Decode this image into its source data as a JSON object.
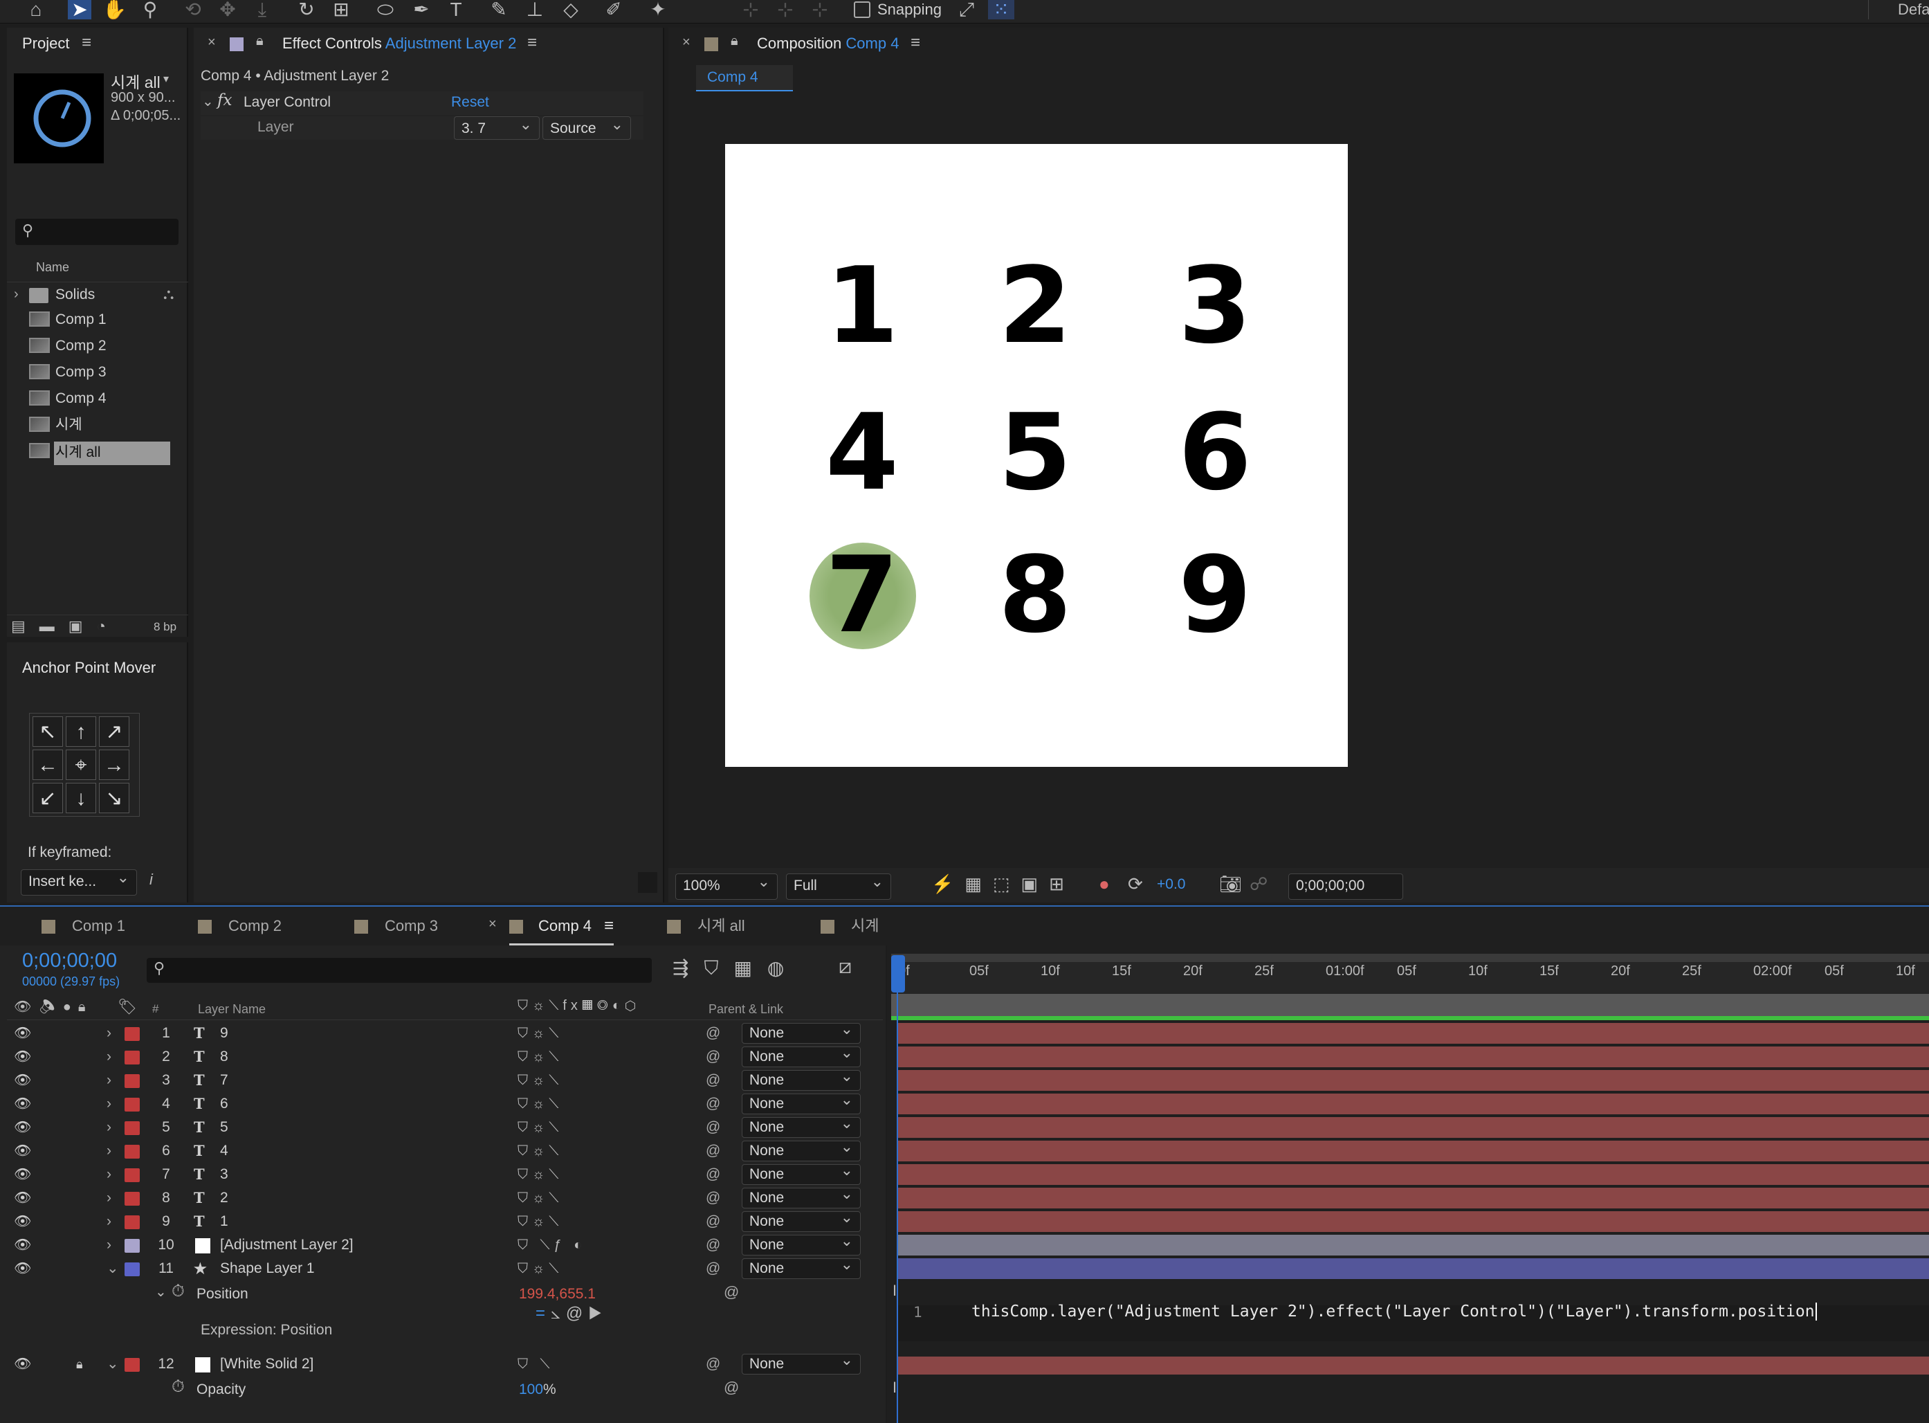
{
  "toolbar": {
    "snapping": "Snapping",
    "workspace": "Defa"
  },
  "project": {
    "title": "Project",
    "item_name": "시계 all",
    "item_dims": "900 x 90...",
    "item_duration": "Δ 0;00;05...",
    "name_col": "Name",
    "bpc": "8 bp",
    "items": [
      {
        "label": "Solids",
        "kind": "folder"
      },
      {
        "label": "Comp 1",
        "kind": "comp"
      },
      {
        "label": "Comp 2",
        "kind": "comp"
      },
      {
        "label": "Comp 3",
        "kind": "comp"
      },
      {
        "label": "Comp 4",
        "kind": "comp"
      },
      {
        "label": "시계",
        "kind": "comp"
      },
      {
        "label": "시계 all",
        "kind": "comp",
        "selected": true
      }
    ]
  },
  "anchor": {
    "title": "Anchor Point Mover",
    "if_keyframed": "If keyframed:",
    "mode": "Insert ke...",
    "info": "i"
  },
  "effect_controls": {
    "title": "Effect Controls",
    "layer": "Adjustment Layer 2",
    "breadcrumb": "Comp 4 • Adjustment Layer 2",
    "fx_label": "fx",
    "effect_name": "Layer Control",
    "reset": "Reset",
    "param": "Layer",
    "layer_value": "3. 7",
    "source": "Source"
  },
  "composition": {
    "title": "Composition",
    "comp": "Comp 4",
    "tab": "Comp 4",
    "numbers": [
      "1",
      "2",
      "3",
      "4",
      "5",
      "6",
      "7",
      "8",
      "9"
    ],
    "zoom": "100%",
    "resolution": "Full",
    "exposure": "+0.0",
    "timecode": "0;00;00;00",
    "highlight_color": "#8fb070"
  },
  "timeline": {
    "tabs": [
      "Comp 1",
      "Comp 2",
      "Comp 3",
      "Comp 4",
      "시계 all",
      "시계"
    ],
    "active_tab": "Comp 4",
    "timecode": "0;00;00;00",
    "fps": "00000 (29.97 fps)",
    "col_num": "#",
    "col_name": "Layer Name",
    "col_parent": "Parent & Link",
    "ruler": [
      "0f",
      "05f",
      "10f",
      "15f",
      "20f",
      "25f",
      "01:00f",
      "05f",
      "10f",
      "15f",
      "20f",
      "25f",
      "02:00f",
      "05f",
      "10f"
    ],
    "layers": [
      {
        "idx": "1",
        "type": "T",
        "name": "9",
        "parent": "None",
        "color": "#c23b3b"
      },
      {
        "idx": "2",
        "type": "T",
        "name": "8",
        "parent": "None",
        "color": "#c23b3b"
      },
      {
        "idx": "3",
        "type": "T",
        "name": "7",
        "parent": "None",
        "color": "#c23b3b"
      },
      {
        "idx": "4",
        "type": "T",
        "name": "6",
        "parent": "None",
        "color": "#c23b3b"
      },
      {
        "idx": "5",
        "type": "T",
        "name": "5",
        "parent": "None",
        "color": "#c23b3b"
      },
      {
        "idx": "6",
        "type": "T",
        "name": "4",
        "parent": "None",
        "color": "#c23b3b"
      },
      {
        "idx": "7",
        "type": "T",
        "name": "3",
        "parent": "None",
        "color": "#c23b3b"
      },
      {
        "idx": "8",
        "type": "T",
        "name": "2",
        "parent": "None",
        "color": "#c23b3b"
      },
      {
        "idx": "9",
        "type": "T",
        "name": "1",
        "parent": "None",
        "color": "#c23b3b"
      },
      {
        "idx": "10",
        "type": "",
        "name": "[Adjustment Layer 2]",
        "parent": "None",
        "color": "#a9a4cc"
      },
      {
        "idx": "11",
        "type": "★",
        "name": "Shape Layer 1",
        "parent": "None",
        "color": "#5b63c9"
      }
    ],
    "position_label": "Position",
    "position_value": "199.4,655.1",
    "expression_label": "Expression: Position",
    "expr_line": "1",
    "expression": "thisComp.layer(\"Adjustment Layer 2\").effect(\"Layer Control\")(\"Layer\").transform.position",
    "solid": {
      "idx": "12",
      "name": "[White Solid 2]",
      "parent": "None"
    },
    "opacity_label": "Opacity",
    "opacity_value": "100",
    "opacity_unit": "%"
  }
}
